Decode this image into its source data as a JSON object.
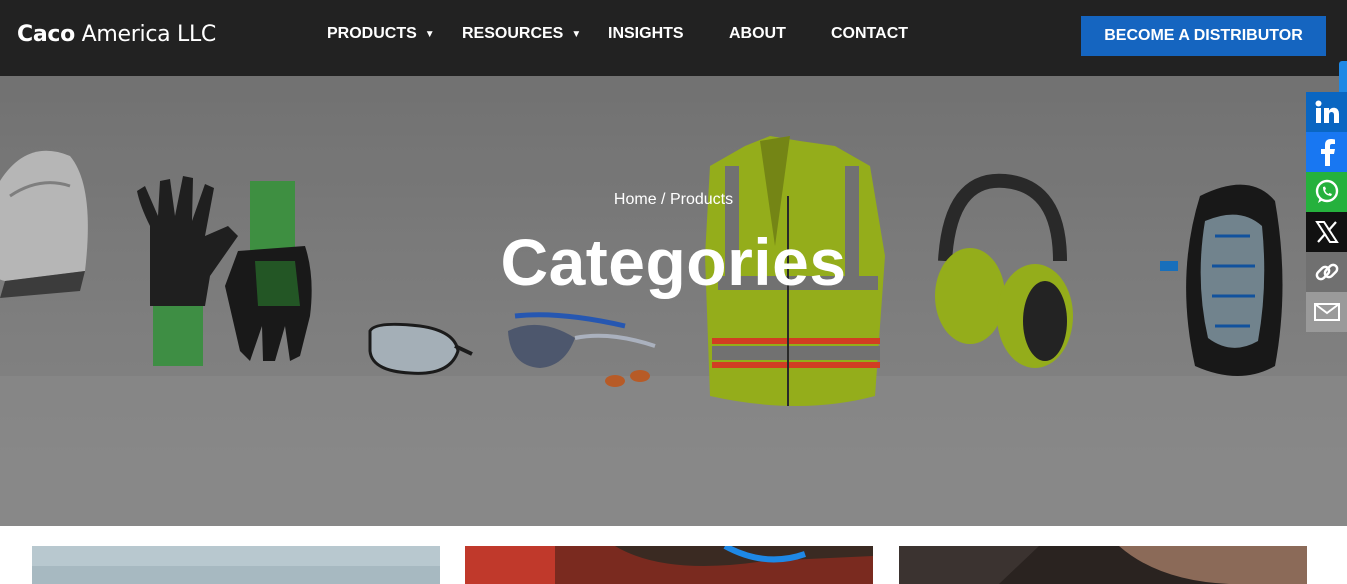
{
  "brand": {
    "logo_bold": "Caco",
    "logo_rest": " America LLC"
  },
  "nav": {
    "items": [
      {
        "label": "PRODUCTS",
        "has_dropdown": true
      },
      {
        "label": "RESOURCES",
        "has_dropdown": true
      },
      {
        "label": "INSIGHTS",
        "has_dropdown": false
      },
      {
        "label": "ABOUT",
        "has_dropdown": false
      },
      {
        "label": "CONTACT",
        "has_dropdown": false
      }
    ],
    "cta_label": "BECOME A DISTRIBUTOR",
    "caret": "▼"
  },
  "hero": {
    "breadcrumb_home": "Home",
    "breadcrumb_separator": " / ",
    "breadcrumb_current": "Products",
    "title": "Categories"
  },
  "share": [
    {
      "name": "linkedin",
      "color": "#0a66c2"
    },
    {
      "name": "facebook",
      "color": "#1877f2"
    },
    {
      "name": "whatsapp",
      "color": "#25b13d"
    },
    {
      "name": "x",
      "color": "#111111"
    },
    {
      "name": "copy-link",
      "color": "#707070"
    },
    {
      "name": "email",
      "color": "#9a9a9a"
    }
  ],
  "colors": {
    "header_bg": "#222222",
    "cta_bg": "#1565c0",
    "vest_yellow": "#b5d321",
    "glove_green": "#3faa3f"
  }
}
